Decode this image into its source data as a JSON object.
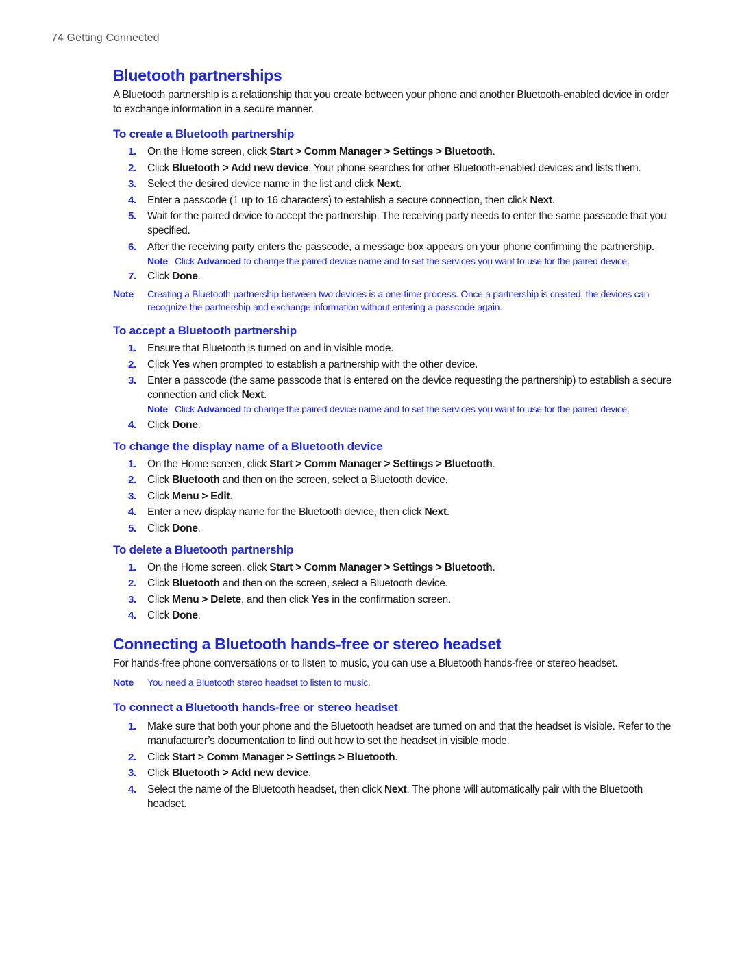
{
  "running_head": "74  Getting Connected",
  "section1": {
    "title": "Bluetooth partnerships",
    "intro": "A Bluetooth partnership is a relationship that you create between your phone and another Bluetooth-enabled device in order to exchange information in a secure manner.",
    "create": {
      "heading": "To create a Bluetooth partnership",
      "steps": [
        {
          "num": "1.",
          "parts": [
            {
              "t": "On the Home screen, click "
            },
            {
              "b": "Start > Comm Manager > Settings > Bluetooth"
            },
            {
              "t": "."
            }
          ]
        },
        {
          "num": "2.",
          "parts": [
            {
              "t": "Click "
            },
            {
              "b": "Bluetooth > Add new device"
            },
            {
              "t": ". Your phone searches for other Bluetooth-enabled devices and lists them."
            }
          ]
        },
        {
          "num": "3.",
          "parts": [
            {
              "t": "Select the desired device name in the list and click "
            },
            {
              "b": "Next"
            },
            {
              "t": "."
            }
          ]
        },
        {
          "num": "4.",
          "parts": [
            {
              "t": "Enter a passcode (1 up to 16 characters) to establish a secure connection, then click "
            },
            {
              "b": "Next"
            },
            {
              "t": "."
            }
          ]
        },
        {
          "num": "5.",
          "parts": [
            {
              "t": "Wait for the paired device to accept the partnership. The receiving party needs to enter the same passcode that you specified."
            }
          ]
        },
        {
          "num": "6.",
          "parts": [
            {
              "t": "After the receiving party enters the passcode, a message box appears on your phone confirming the partnership."
            }
          ],
          "note": {
            "label": "Note",
            "parts": [
              {
                "t": "Click "
              },
              {
                "b": "Advanced"
              },
              {
                "t": " to change the paired device name and to set the services you want to use for the paired device."
              }
            ]
          }
        },
        {
          "num": "7.",
          "parts": [
            {
              "t": "Click "
            },
            {
              "b": "Done"
            },
            {
              "t": "."
            }
          ]
        }
      ],
      "note": {
        "label": "Note",
        "text": "Creating a Bluetooth partnership between two devices is a one-time process. Once a partnership is created, the devices can recognize the partnership and exchange information without entering a passcode again."
      }
    },
    "accept": {
      "heading": "To accept a Bluetooth partnership",
      "steps": [
        {
          "num": "1.",
          "parts": [
            {
              "t": "Ensure that Bluetooth is turned on and in visible mode."
            }
          ]
        },
        {
          "num": "2.",
          "parts": [
            {
              "t": "Click "
            },
            {
              "b": "Yes"
            },
            {
              "t": " when prompted to establish a partnership with the other device."
            }
          ]
        },
        {
          "num": "3.",
          "parts": [
            {
              "t": "Enter a passcode (the same passcode that is entered on the device requesting the partnership) to establish a secure connection and click "
            },
            {
              "b": "Next"
            },
            {
              "t": "."
            }
          ],
          "note": {
            "label": "Note",
            "parts": [
              {
                "t": "Click "
              },
              {
                "b": "Advanced"
              },
              {
                "t": " to change the paired device name and to set the services you want to use for the paired device."
              }
            ]
          }
        },
        {
          "num": "4.",
          "parts": [
            {
              "t": "Click "
            },
            {
              "b": "Done"
            },
            {
              "t": "."
            }
          ]
        }
      ]
    },
    "rename": {
      "heading": "To change the display name of a Bluetooth device",
      "steps": [
        {
          "num": "1.",
          "parts": [
            {
              "t": "On the Home screen, click "
            },
            {
              "b": "Start > Comm Manager > Settings > Bluetooth"
            },
            {
              "t": "."
            }
          ]
        },
        {
          "num": "2.",
          "parts": [
            {
              "t": "Click "
            },
            {
              "b": "Bluetooth"
            },
            {
              "t": " and then on the screen, select a Bluetooth device."
            }
          ]
        },
        {
          "num": "3.",
          "parts": [
            {
              "t": "Click "
            },
            {
              "b": "Menu > Edit"
            },
            {
              "t": "."
            }
          ]
        },
        {
          "num": "4.",
          "parts": [
            {
              "t": "Enter a new display name for the Bluetooth device, then click "
            },
            {
              "b": "Next"
            },
            {
              "t": "."
            }
          ]
        },
        {
          "num": "5.",
          "parts": [
            {
              "t": "Click "
            },
            {
              "b": "Done"
            },
            {
              "t": "."
            }
          ]
        }
      ]
    },
    "delete": {
      "heading": "To delete a Bluetooth partnership",
      "steps": [
        {
          "num": "1.",
          "parts": [
            {
              "t": "On the Home screen, click "
            },
            {
              "b": "Start > Comm Manager > Settings > Bluetooth"
            },
            {
              "t": "."
            }
          ]
        },
        {
          "num": "2.",
          "parts": [
            {
              "t": "Click "
            },
            {
              "b": "Bluetooth"
            },
            {
              "t": " and then on the screen, select a Bluetooth device."
            }
          ]
        },
        {
          "num": "3.",
          "parts": [
            {
              "t": "Click "
            },
            {
              "b": "Menu > Delete"
            },
            {
              "t": ", and then click "
            },
            {
              "b": "Yes"
            },
            {
              "t": " in the confirmation screen."
            }
          ]
        },
        {
          "num": "4.",
          "parts": [
            {
              "t": "Click "
            },
            {
              "b": "Done"
            },
            {
              "t": "."
            }
          ]
        }
      ]
    }
  },
  "section2": {
    "title": "Connecting a Bluetooth hands-free or stereo headset",
    "intro": "For hands-free phone conversations or to listen to music, you can use a Bluetooth hands-free or stereo headset.",
    "note": {
      "label": "Note",
      "text": "You need a Bluetooth stereo headset to listen to music."
    },
    "connect": {
      "heading": "To connect a Bluetooth hands-free or stereo headset",
      "steps": [
        {
          "num": "1.",
          "parts": [
            {
              "t": "Make sure that both your phone and the Bluetooth headset are turned on and that the headset is visible. Refer to the manufacturer’s documentation to find out how to set the headset in visible mode."
            }
          ]
        },
        {
          "num": "2.",
          "parts": [
            {
              "t": "Click "
            },
            {
              "b": "Start > Comm Manager > Settings > Bluetooth"
            },
            {
              "t": "."
            }
          ]
        },
        {
          "num": "3.",
          "parts": [
            {
              "t": "Click "
            },
            {
              "b": "Bluetooth > Add new device"
            },
            {
              "t": "."
            }
          ]
        },
        {
          "num": "4.",
          "parts": [
            {
              "t": "Select the name of the Bluetooth headset, then click "
            },
            {
              "b": "Next"
            },
            {
              "t": ". The phone will automatically pair with the Bluetooth headset."
            }
          ]
        }
      ]
    }
  },
  "colors": {
    "accent": "#1f2ad6",
    "text": "#1a1a1a",
    "running_head": "#555555"
  }
}
